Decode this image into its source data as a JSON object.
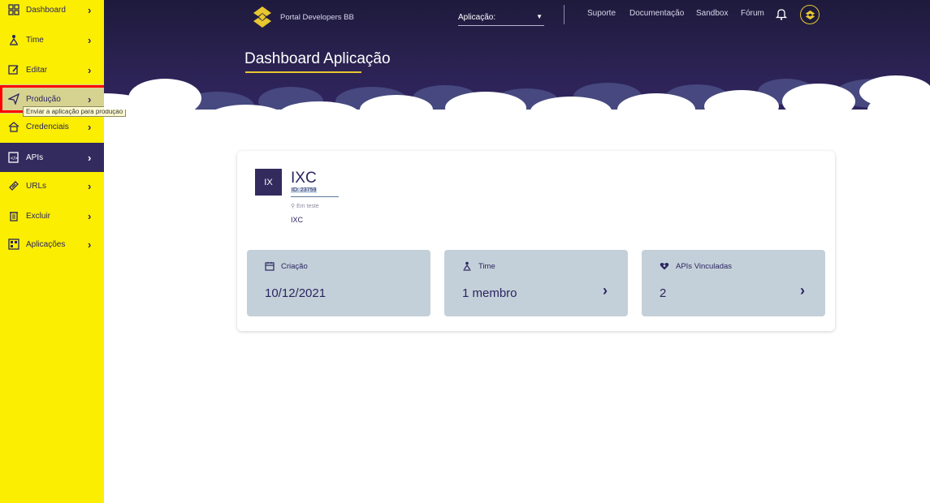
{
  "sidebar": {
    "items": [
      {
        "label": "Dashboard",
        "icon": "dashboard-grid-icon"
      },
      {
        "label": "Time",
        "icon": "team-icon"
      },
      {
        "label": "Editar",
        "icon": "edit-icon"
      },
      {
        "label": "Produção",
        "icon": "send-icon"
      },
      {
        "label": "Credenciais",
        "icon": "home-key-icon"
      },
      {
        "label": "APIs",
        "icon": "api-icon"
      },
      {
        "label": "URLs",
        "icon": "link-icon"
      },
      {
        "label": "Excluir",
        "icon": "trash-icon"
      },
      {
        "label": "Aplicações",
        "icon": "applications-icon"
      }
    ],
    "active_item": "APIs",
    "hovered_item": "Produção",
    "tooltip": "Enviar a aplicação para produção"
  },
  "header": {
    "brand": "Portal Developers BB",
    "app_select_label": "Aplicação:",
    "links": [
      "Suporte",
      "Documentação",
      "Sandbox",
      "Fórum"
    ],
    "page_title": "Dashboard Aplicação"
  },
  "app": {
    "avatar_text": "IX",
    "name": "IXC",
    "id": "ID: 23759",
    "status": "Em teste",
    "description": "IXC"
  },
  "stats": [
    {
      "label": "Criação",
      "value": "10/12/2021",
      "icon": "calendar-icon",
      "has_chevron": false
    },
    {
      "label": "Time",
      "value": "1 membro",
      "icon": "team-icon",
      "has_chevron": true
    },
    {
      "label": "APIs Vinculadas",
      "value": "2",
      "icon": "heart-api-icon",
      "has_chevron": true
    }
  ],
  "colors": {
    "sidebar_bg": "#fbee00",
    "header_bg": "#2b2252",
    "accent": "#e8c730",
    "card_stat_bg": "#c4d0d9",
    "highlight": "#ff0000"
  }
}
